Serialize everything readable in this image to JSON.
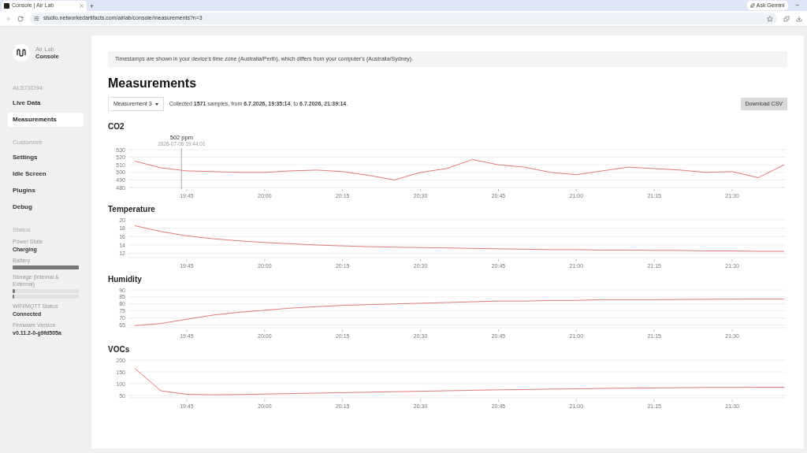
{
  "browser": {
    "tab_title": "Console | Air Lab",
    "new_tab": "+",
    "url": "studio.networkedartifacts.com/airlab/console/measurements?n=3",
    "gemini": "Ask Gemini",
    "minimize": "–"
  },
  "sidebar": {
    "brand_top": "Air Lab",
    "brand_bottom": "Console",
    "device": "AL573D94",
    "nav": [
      {
        "label": "Live Data",
        "selected": false
      },
      {
        "label": "Measurements",
        "selected": true
      }
    ],
    "customize_title": "Customize",
    "customize": [
      {
        "label": "Settings",
        "selected": false
      },
      {
        "label": "Idle Screen",
        "selected": false
      },
      {
        "label": "Plugins",
        "selected": false
      },
      {
        "label": "Debug",
        "selected": false
      }
    ],
    "status_title": "Status",
    "status": [
      {
        "kind": "text",
        "label": "Power State",
        "value": "Charging"
      },
      {
        "kind": "bars",
        "label": "Battery",
        "bars": [
          {
            "level": 1.0
          }
        ]
      },
      {
        "kind": "bars",
        "label": "Storage (Internal & External)",
        "bars": [
          {
            "level": 0.04
          },
          {
            "level": 0.02
          }
        ]
      },
      {
        "kind": "text",
        "label": "WiFi/MQTT Status",
        "value": "Connected"
      },
      {
        "kind": "text",
        "label": "Firmware Version",
        "value": "v0.11.2-0-g9fd505a"
      }
    ]
  },
  "notice": "Timestamps are shown in your device's time zone (Australia/Perth), which differs from your computer's (Australia/Sydney).",
  "title": "Measurements",
  "measurement_select": "Measurement 3",
  "summary": "Collected **1571** samples, from **6.7.2026, 19:35:14**, to **6.7.2026, 21:39:14**.",
  "download": "Download CSV",
  "charts": [
    {
      "chart_data": {
        "type": "line",
        "categories": [
          null,
          null,
          "19:45",
          null,
          null,
          "20:00",
          null,
          null,
          "20:15",
          null,
          null,
          "20:30",
          null,
          null,
          "20:45",
          null,
          null,
          "21:00",
          null,
          null,
          "21:15",
          null,
          null,
          "21:30",
          null,
          null
        ],
        "grid": true,
        "ylim": [
          480,
          530
        ],
        "yticks": [
          480,
          490,
          500,
          510,
          520,
          530
        ],
        "series": [
          {
            "name": "CO2",
            "color": "#e07a7a",
            "values": [
              515,
              506,
              502,
              501,
              500,
              500,
              502,
              503,
              501,
              496,
              490,
              500,
              505,
              517,
              510,
              507,
              500,
              497,
              502,
              507,
              505,
              503,
              500,
              501,
              493,
              510
            ]
          }
        ],
        "annotations": [
          "502 ppm",
          "2026-07-06 19:44:01"
        ]
      }
    },
    {
      "chart_data": {
        "type": "line",
        "categories": [
          null,
          null,
          "19:45",
          null,
          null,
          "20:00",
          null,
          null,
          "20:15",
          null,
          null,
          "20:30",
          null,
          null,
          "20:45",
          null,
          null,
          "21:00",
          null,
          null,
          "21:15",
          null,
          null,
          "21:30",
          null,
          null
        ],
        "grid": true,
        "ylim": [
          11,
          20
        ],
        "yticks": [
          12,
          14,
          16,
          18,
          20
        ],
        "series": [
          {
            "name": "Temperature",
            "color": "#e07a7a",
            "values": [
              18.6,
              17.2,
              16.2,
              15.5,
              15.0,
              14.6,
              14.3,
              14.0,
              13.8,
              13.6,
              13.5,
              13.4,
              13.3,
              13.2,
              13.1,
              13.0,
              12.9,
              12.9,
              12.8,
              12.8,
              12.7,
              12.7,
              12.6,
              12.6,
              12.5,
              12.5
            ]
          }
        ]
      }
    },
    {
      "chart_data": {
        "type": "line",
        "categories": [
          null,
          null,
          "19:45",
          null,
          null,
          "20:00",
          null,
          null,
          "20:15",
          null,
          null,
          "20:30",
          null,
          null,
          "20:45",
          null,
          null,
          "21:00",
          null,
          null,
          "21:15",
          null,
          null,
          "21:30",
          null,
          null
        ],
        "grid": true,
        "ylim": [
          63,
          90
        ],
        "yticks": [
          65,
          70,
          75,
          80,
          85,
          90
        ],
        "series": [
          {
            "name": "Humidity",
            "color": "#e07a7a",
            "values": [
              64.5,
              66,
              69,
              72,
              74,
              75.5,
              77,
              78,
              79,
              79.5,
              80,
              80.5,
              81,
              81.5,
              82,
              82,
              82.5,
              82.5,
              83,
              83,
              83,
              83.2,
              83.3,
              83.4,
              83.5,
              83.5
            ]
          }
        ]
      }
    },
    {
      "chart_data": {
        "type": "line",
        "categories": [
          null,
          null,
          "19:45",
          null,
          null,
          "20:00",
          null,
          null,
          "20:15",
          null,
          null,
          "20:30",
          null,
          null,
          "20:45",
          null,
          null,
          "21:00",
          null,
          null,
          "21:15",
          null,
          null,
          "21:30",
          null,
          null
        ],
        "grid": true,
        "ylim": [
          40,
          200
        ],
        "yticks": [
          50,
          100,
          150,
          200
        ],
        "series": [
          {
            "name": "VOCs",
            "color": "#e07a7a",
            "values": [
              165,
              70,
              55,
              53,
              54,
              56,
              58,
              60,
              62,
              64,
              66,
              68,
              70,
              72,
              74,
              75,
              77,
              78,
              80,
              81,
              82,
              83,
              84,
              84,
              85,
              85
            ]
          }
        ]
      }
    }
  ]
}
